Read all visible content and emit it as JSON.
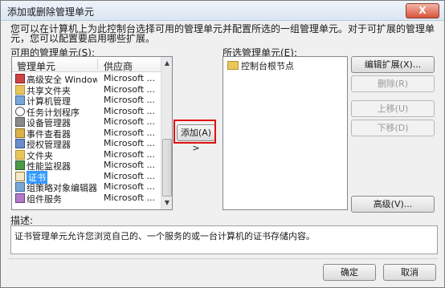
{
  "window": {
    "title": "添加或删除管理单元",
    "close_label": "X"
  },
  "intro_text": "您可以在计算机上为此控制台选择可用的管理单元并配置所选的一组管理单元。对于可扩展的管理单元，您可以配置要启用哪些扩展。",
  "available": {
    "label": "可用的管理单元(S):",
    "col_name": "管理单元",
    "col_vendor": "供应商",
    "items": [
      {
        "name": "高级安全 Window...",
        "vendor": "Microsoft ...",
        "icon": "firewall-icon"
      },
      {
        "name": "共享文件夹",
        "vendor": "Microsoft ...",
        "icon": "shared-folder-icon"
      },
      {
        "name": "计算机管理",
        "vendor": "Microsoft ...",
        "icon": "computer-management-icon"
      },
      {
        "name": "任务计划程序",
        "vendor": "Microsoft ...",
        "icon": "clock-icon"
      },
      {
        "name": "设备管理器",
        "vendor": "Microsoft ...",
        "icon": "device-manager-icon"
      },
      {
        "name": "事件查看器",
        "vendor": "Microsoft ...",
        "icon": "event-viewer-icon"
      },
      {
        "name": "授权管理器",
        "vendor": "Microsoft ...",
        "icon": "authorization-icon"
      },
      {
        "name": "文件夹",
        "vendor": "Microsoft ...",
        "icon": "folder-icon"
      },
      {
        "name": "性能监视器",
        "vendor": "Microsoft ...",
        "icon": "performance-icon"
      },
      {
        "name": "证书",
        "vendor": "Microsoft ...",
        "icon": "certificate-icon"
      },
      {
        "name": "组策略对象编辑器",
        "vendor": "Microsoft ...",
        "icon": "group-policy-icon"
      },
      {
        "name": "组件服务",
        "vendor": "Microsoft ...",
        "icon": "component-services-icon"
      }
    ]
  },
  "selected": {
    "label": "所选管理单元(E):",
    "root_item": "控制台根节点"
  },
  "buttons": {
    "add": "添加(A) >",
    "edit_extensions": "编辑扩展(X)...",
    "remove": "删除(R)",
    "move_up": "上移(U)",
    "move_down": "下移(D)",
    "advanced": "高级(V)...",
    "ok": "确定",
    "cancel": "取消"
  },
  "description": {
    "label": "描述:",
    "text": "证书管理单元允许您浏览自己的、一个服务的或一台计算机的证书存储内容。"
  },
  "colors": {
    "highlight_red": "#e01010",
    "selection_blue": "#3399ff"
  }
}
